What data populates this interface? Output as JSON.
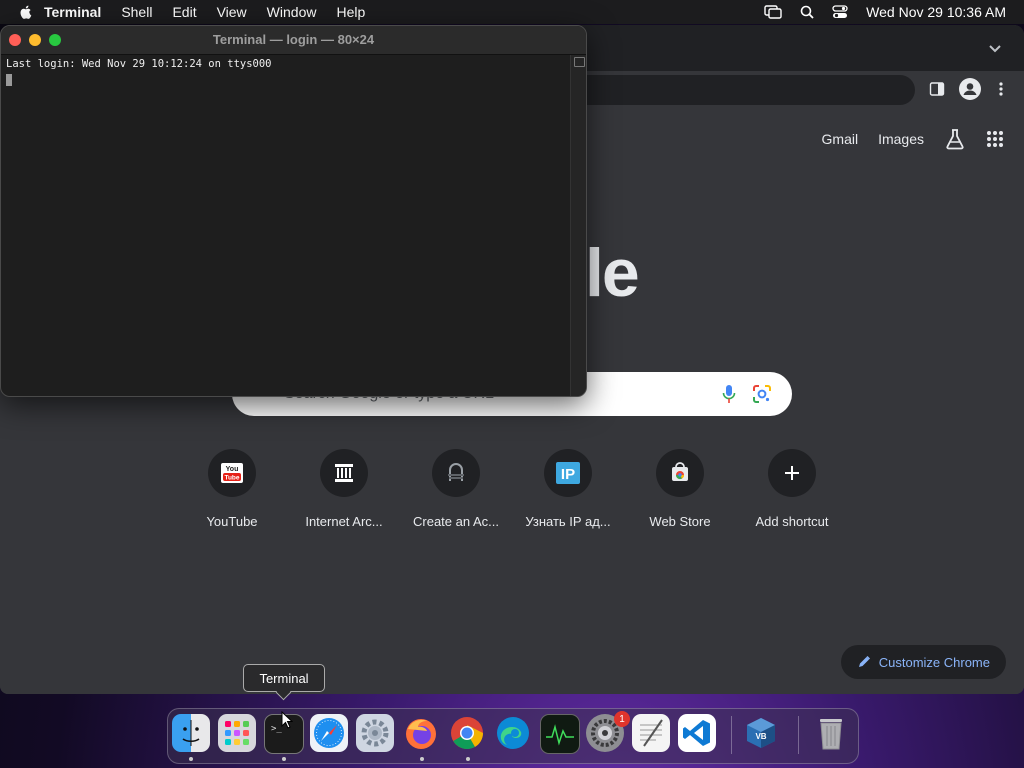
{
  "menubar": {
    "app_name": "Terminal",
    "items": [
      "Shell",
      "Edit",
      "View",
      "Window",
      "Help"
    ],
    "clock": "Wed Nov 29  10:36 AM"
  },
  "terminal": {
    "title": "Terminal — login — 80×24",
    "output_line": "Last login: Wed Nov 29 10:12:24 on ttys000"
  },
  "chrome": {
    "top_links": [
      "Gmail",
      "Images"
    ],
    "logo_fragment": "le",
    "search_placeholder": "Search Google or type a URL",
    "shortcuts": [
      {
        "label": "YouTube",
        "icon": "youtube-icon"
      },
      {
        "label": "Internet Arc...",
        "icon": "internet-archive-icon"
      },
      {
        "label": "Create an Ac...",
        "icon": "create-account-icon"
      },
      {
        "label": "Узнать IP ад...",
        "icon": "ip-icon"
      },
      {
        "label": "Web Store",
        "icon": "web-store-icon"
      },
      {
        "label": "Add shortcut",
        "icon": "plus-icon"
      }
    ],
    "customize_label": "Customize Chrome"
  },
  "tooltip": "Terminal",
  "dock": {
    "apps": [
      "Finder",
      "Launchpad",
      "Terminal",
      "Safari",
      "Utility",
      "Firefox",
      "Google Chrome",
      "Microsoft Edge",
      "Activity Monitor",
      "System Settings",
      "TextEdit",
      "Visual Studio Code",
      "VirtualBox",
      "Trash"
    ],
    "settings_badge": "1"
  },
  "colors": {
    "accent": "#8ab4f8",
    "ntp_bg": "#35363a",
    "terminal_bg": "#1e1e1e"
  }
}
